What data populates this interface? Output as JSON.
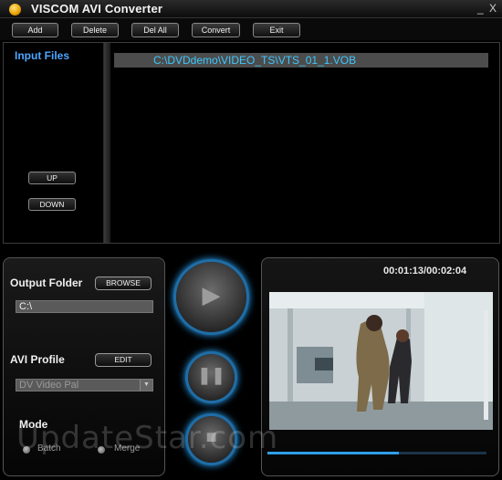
{
  "window": {
    "title": "VISCOM AVI Converter",
    "minimize": "_",
    "close": "X"
  },
  "toolbar": {
    "add": "Add",
    "delete": "Delete",
    "del_all": "Del All",
    "convert": "Convert",
    "exit": "Exit"
  },
  "input": {
    "label": "Input Files",
    "up": "UP",
    "down": "DOWN",
    "files": [
      "C:\\DVDdemo\\VIDEO_TS\\VTS_01_1.VOB"
    ]
  },
  "output": {
    "folder_label": "Output Folder",
    "browse": "BROWSE",
    "folder_value": "C:\\",
    "profile_label": "AVI Profile",
    "edit": "EDIT",
    "profile_value": "DV Video Pal",
    "mode_label": "Mode",
    "mode_batch": "Batch",
    "mode_merge": "Merge"
  },
  "player": {
    "time": "00:01:13/00:02:04",
    "progress": 0.6
  },
  "watermark": "UpdateStar.com",
  "colors": {
    "accent": "#2aa7ff",
    "file_text": "#3dc7ff",
    "label_blue": "#4ea6ff"
  }
}
